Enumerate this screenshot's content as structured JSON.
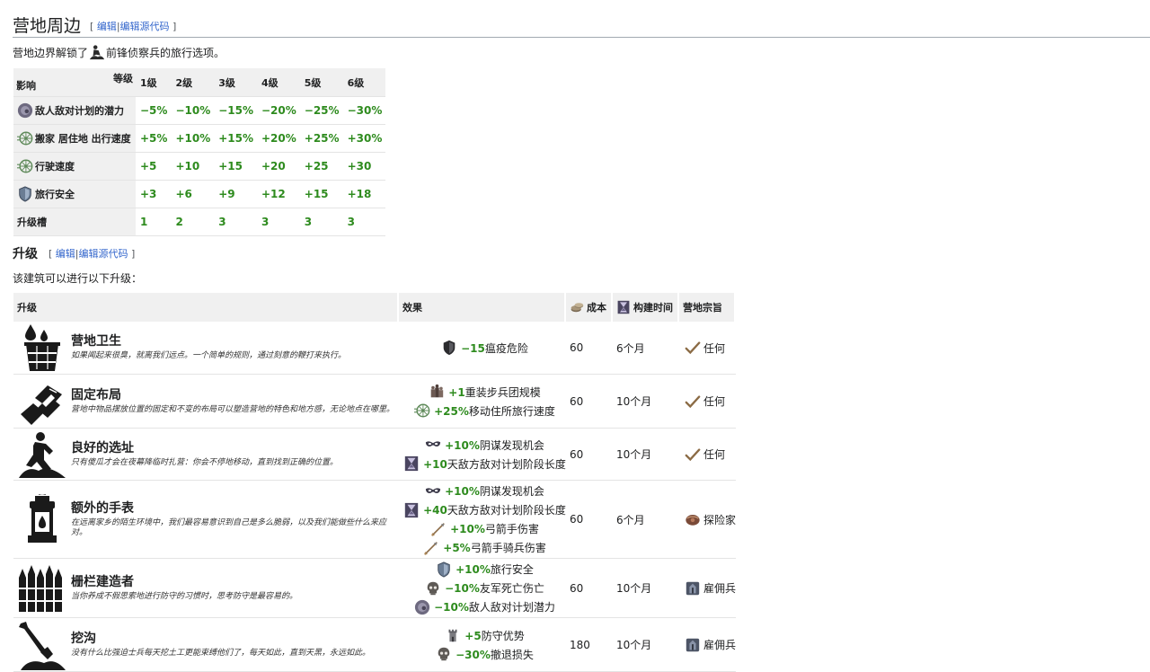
{
  "section1": {
    "title": "营地周边",
    "edit_open": "[ ",
    "edit_link": "编辑",
    "edit_sep": "|",
    "edit_source": "编辑源代码",
    "edit_close": " ]"
  },
  "intro": {
    "before": "营地边界解锁了",
    "after": "前锋侦察兵的旅行选项。"
  },
  "level_table": {
    "corner_top": "等级",
    "corner_bottom": "影响",
    "levels": [
      "1级",
      "2级",
      "3级",
      "4级",
      "5级",
      "6级"
    ],
    "rows": [
      {
        "label": "敌人敌对计划的潜力",
        "icon": "gray-orb-icon",
        "values": [
          "−5%",
          "−10%",
          "−15%",
          "−20%",
          "−25%",
          "−30%"
        ]
      },
      {
        "label": "搬家 居住地 出行速度",
        "icon": "wheel-icon",
        "values": [
          "+5%",
          "+10%",
          "+15%",
          "+20%",
          "+25%",
          "+30%"
        ]
      },
      {
        "label": "行驶速度",
        "icon": "wheel-icon",
        "values": [
          "+5",
          "+10",
          "+15",
          "+20",
          "+25",
          "+30"
        ]
      },
      {
        "label": "旅行安全",
        "icon": "shield-icon",
        "values": [
          "+3",
          "+6",
          "+9",
          "+12",
          "+15",
          "+18"
        ]
      },
      {
        "label": "升级槽",
        "icon": "",
        "values": [
          "1",
          "2",
          "3",
          "3",
          "3",
          "3"
        ]
      }
    ]
  },
  "section2": {
    "title": "升级",
    "edit_open": "[ ",
    "edit_link": "编辑",
    "edit_sep": "|",
    "edit_source": "编辑源代码",
    "edit_close": " ]"
  },
  "section2_sub": "该建筑可以进行以下升级：",
  "upgrade_table": {
    "headers": {
      "upgrade": "升级",
      "effect": "效果",
      "cost": "成本",
      "time": "构建时间",
      "purpose": "营地宗旨"
    },
    "rows": [
      {
        "name": "营地卫生",
        "icon": "bucket-icon",
        "desc": "如果闻起来很臭，就离我们远点。一个简单的规则，通过刻意的鞭打来执行。",
        "effects": [
          {
            "icon": "shield-dark-icon",
            "num": "−15",
            "text": "瘟疫危险"
          }
        ],
        "cost": "60",
        "time": "6个月",
        "purpose": "任何",
        "purpose_icon": "check-icon"
      },
      {
        "name": "固定布局",
        "icon": "map-papers-icon",
        "desc": "营地中物品摆放位置的固定和不变的布局可以塑造营地的特色和地方感，无论地点在哪里。",
        "effects": [
          {
            "icon": "soldiers-icon",
            "num": "+1",
            "text": "重装步兵团规模"
          },
          {
            "icon": "wheel-icon",
            "num": "+25%",
            "text": "移动住所旅行速度"
          }
        ],
        "cost": "60",
        "time": "10个月",
        "purpose": "任何",
        "purpose_icon": "check-icon"
      },
      {
        "name": "良好的选址",
        "icon": "scout-icon",
        "desc": "只有傻瓜才会在夜幕降临时扎营：你会不停地移动，直到找到正确的位置。",
        "effects": [
          {
            "icon": "mask-icon",
            "num": "+10%",
            "text": "阴谋发现机会"
          },
          {
            "icon": "hourglass-icon",
            "num": "+10",
            "text": "天敌方敌对计划阶段长度"
          }
        ],
        "cost": "60",
        "time": "10个月",
        "purpose": "任何",
        "purpose_icon": "check-icon"
      },
      {
        "name": "额外的手表",
        "icon": "lantern-icon",
        "desc": "在远离家乡的陌生环境中，我们最容易意识到自己是多么脆弱，以及我们能做些什么来应对。",
        "effects": [
          {
            "icon": "mask-icon",
            "num": "+10%",
            "text": "阴谋发现机会"
          },
          {
            "icon": "hourglass-icon",
            "num": "+40",
            "text": "天敌方敌对计划阶段长度"
          },
          {
            "icon": "arrow-icon",
            "num": "+10%",
            "text": "弓箭手伤害"
          },
          {
            "icon": "arrow-icon",
            "num": "+5%",
            "text": "弓箭手骑兵伤害"
          }
        ],
        "cost": "60",
        "time": "6个月",
        "purpose": "探险家",
        "purpose_icon": "explorer-icon"
      },
      {
        "name": "栅栏建造者",
        "icon": "palisade-icon",
        "desc": "当你养成不假思索地进行防守的习惯时，思考防守是最容易的。",
        "effects": [
          {
            "icon": "shield-icon",
            "num": "+10%",
            "text": "旅行安全"
          },
          {
            "icon": "skull-icon",
            "num": "−10%",
            "text": "友军死亡伤亡"
          },
          {
            "icon": "gray-orb-icon",
            "num": "−10%",
            "text": "敌人敌对计划潜力"
          }
        ],
        "cost": "60",
        "time": "10个月",
        "purpose": "雇佣兵",
        "purpose_icon": "mercenary-icon"
      },
      {
        "name": "挖沟",
        "icon": "shovel-icon",
        "desc": "没有什么比强迫士兵每天挖土工更能束缚他们了，每天如此，直到天黑，永远如此。",
        "effects": [
          {
            "icon": "tower-icon",
            "num": "+5",
            "text": "防守优势"
          },
          {
            "icon": "skull-icon",
            "num": "−30%",
            "text": "撤退损失"
          }
        ],
        "cost": "180",
        "time": "10个月",
        "purpose": "雇佣兵",
        "purpose_icon": "mercenary-icon"
      }
    ]
  },
  "colors": {
    "positive": "#2e8b1e",
    "link": "#3366cc",
    "header_bg": "#f0f0f0"
  }
}
